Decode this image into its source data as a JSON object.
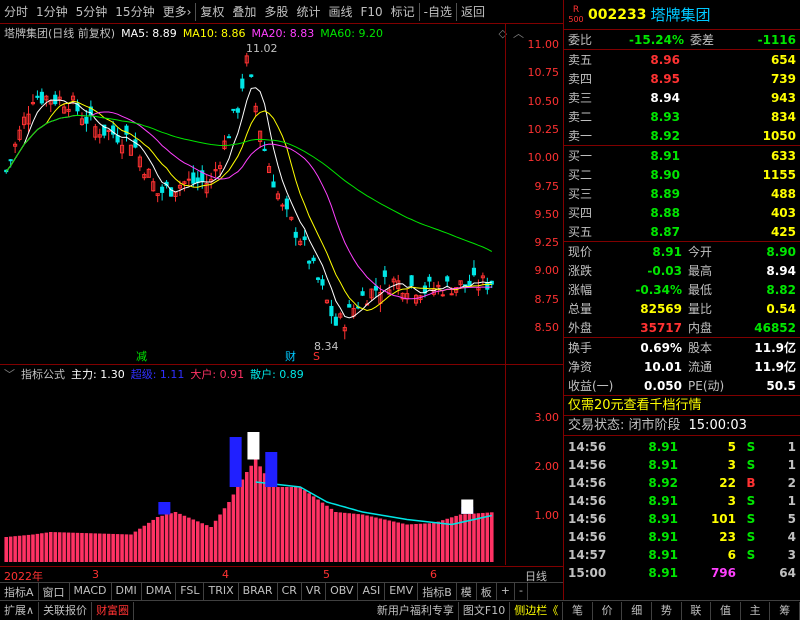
{
  "toolbar": {
    "items": [
      "分时",
      "1分钟",
      "5分钟",
      "15分钟",
      "更多›",
      "复权",
      "叠加",
      "多股",
      "统计",
      "画线",
      "F10",
      "标记",
      "-自选",
      "返回"
    ]
  },
  "chart_header": {
    "title": "塔牌集团(日线 前复权)",
    "ma5": "MA5: 8.89",
    "ma10": "MA10: 8.86",
    "ma20": "MA20: 8.83",
    "ma60": "MA60: 9.20"
  },
  "main_chart": {
    "high_label": "11.02",
    "low_label": "8.34",
    "marker_jian": "减",
    "marker_cai": "财",
    "marker_s": "S"
  },
  "indicator": {
    "name": "指标公式",
    "zhuli": "主力: 1.30",
    "sanhu_label": "超级: 1.11",
    "dahu": "大户: 0.91",
    "sanhu": "散户: 0.89"
  },
  "x_axis": [
    "2022年",
    "3",
    "4",
    "5",
    "6"
  ],
  "x_axis_right": "日线",
  "tabs": [
    "指标A",
    "窗口",
    "MACD",
    "DMI",
    "DMA",
    "FSL",
    "TRIX",
    "BRAR",
    "CR",
    "VR",
    "OBV",
    "ASI",
    "EMV",
    "指标B",
    "模",
    "板",
    "+",
    "-"
  ],
  "bottom_bar": {
    "left": [
      "扩展∧",
      "关联报价",
      "财富圈"
    ],
    "right": [
      "新用户福利专享",
      "图文F10",
      "侧边栏《"
    ],
    "right_tabs": [
      "笔",
      "价",
      "细",
      "势",
      "联",
      "值",
      "主",
      "筹"
    ]
  },
  "stock": {
    "badge_top": "R",
    "badge_bottom": "500",
    "code": "002233",
    "name": "塔牌集团"
  },
  "weibi": {
    "label1": "委比",
    "value1": "-15.24%",
    "label2": "委差",
    "value2": "-1116"
  },
  "asks": [
    {
      "label": "卖五",
      "price": "8.96",
      "vol": "654",
      "color": "red"
    },
    {
      "label": "卖四",
      "price": "8.95",
      "vol": "739",
      "color": "red"
    },
    {
      "label": "卖三",
      "price": "8.94",
      "vol": "943",
      "color": "white"
    },
    {
      "label": "卖二",
      "price": "8.93",
      "vol": "834",
      "color": "green"
    },
    {
      "label": "卖一",
      "price": "8.92",
      "vol": "1050",
      "color": "green"
    }
  ],
  "bids": [
    {
      "label": "买一",
      "price": "8.91",
      "vol": "633",
      "color": "green"
    },
    {
      "label": "买二",
      "price": "8.90",
      "vol": "1155",
      "color": "green"
    },
    {
      "label": "买三",
      "price": "8.89",
      "vol": "488",
      "color": "green"
    },
    {
      "label": "买四",
      "price": "8.88",
      "vol": "403",
      "color": "green"
    },
    {
      "label": "买五",
      "price": "8.87",
      "vol": "425",
      "color": "green"
    }
  ],
  "quote1": [
    {
      "k1": "现价",
      "v1": "8.91",
      "c1": "green",
      "k2": "今开",
      "v2": "8.90",
      "c2": "green"
    },
    {
      "k1": "涨跌",
      "v1": "-0.03",
      "c1": "green",
      "k2": "最高",
      "v2": "8.94",
      "c2": "white"
    },
    {
      "k1": "涨幅",
      "v1": "-0.34%",
      "c1": "green",
      "k2": "最低",
      "v2": "8.82",
      "c2": "green"
    },
    {
      "k1": "总量",
      "v1": "82569",
      "c1": "yellow",
      "k2": "量比",
      "v2": "0.54",
      "c2": "yellow"
    },
    {
      "k1": "外盘",
      "v1": "35717",
      "c1": "red",
      "k2": "内盘",
      "v2": "46852",
      "c2": "green"
    }
  ],
  "quote2": [
    {
      "k1": "换手",
      "v1": "0.69%",
      "k2": "股本",
      "v2": "11.9亿"
    },
    {
      "k1": "净资",
      "v1": "10.01",
      "k2": "流通",
      "v2": "11.9亿"
    },
    {
      "k1": "收益(一)",
      "v1": "0.050",
      "k2": "PE(动)",
      "v2": "50.5"
    }
  ],
  "promo": "仅需20元查看千档行情",
  "trade_status": {
    "label": "交易状态: 闭市阶段",
    "time": "15:00:03"
  },
  "ticks": [
    {
      "t": "14:56",
      "p": "8.91",
      "v": "5",
      "s": "S",
      "n": "1",
      "pc": "green",
      "sc": "green",
      "vc": "yellow"
    },
    {
      "t": "14:56",
      "p": "8.91",
      "v": "3",
      "s": "S",
      "n": "1",
      "pc": "green",
      "sc": "green",
      "vc": "yellow"
    },
    {
      "t": "14:56",
      "p": "8.92",
      "v": "22",
      "s": "B",
      "n": "2",
      "pc": "green",
      "sc": "red",
      "vc": "yellow"
    },
    {
      "t": "14:56",
      "p": "8.91",
      "v": "3",
      "s": "S",
      "n": "1",
      "pc": "green",
      "sc": "green",
      "vc": "yellow"
    },
    {
      "t": "14:56",
      "p": "8.91",
      "v": "101",
      "s": "S",
      "n": "5",
      "pc": "green",
      "sc": "green",
      "vc": "yellow"
    },
    {
      "t": "14:56",
      "p": "8.91",
      "v": "23",
      "s": "S",
      "n": "4",
      "pc": "green",
      "sc": "green",
      "vc": "yellow"
    },
    {
      "t": "14:57",
      "p": "8.91",
      "v": "6",
      "s": "S",
      "n": "3",
      "pc": "green",
      "sc": "green",
      "vc": "yellow"
    },
    {
      "t": "15:00",
      "p": "8.91",
      "v": "796",
      "s": "",
      "n": "64",
      "pc": "green",
      "sc": "green",
      "vc": "magenta"
    }
  ],
  "y_ticks": [
    "11.00",
    "10.75",
    "10.50",
    "10.25",
    "10.00",
    "9.75",
    "9.50",
    "9.25",
    "9.00",
    "8.75",
    "8.50"
  ],
  "ind_ticks": [
    "3.00",
    "2.00",
    "1.00"
  ],
  "colors": {
    "up": "#ff3232",
    "down": "#00e6e6",
    "ma5": "#ffffff",
    "ma10": "#ffff00",
    "ma20": "#ff40ff",
    "ma60": "#00e600",
    "frame": "#800000"
  }
}
